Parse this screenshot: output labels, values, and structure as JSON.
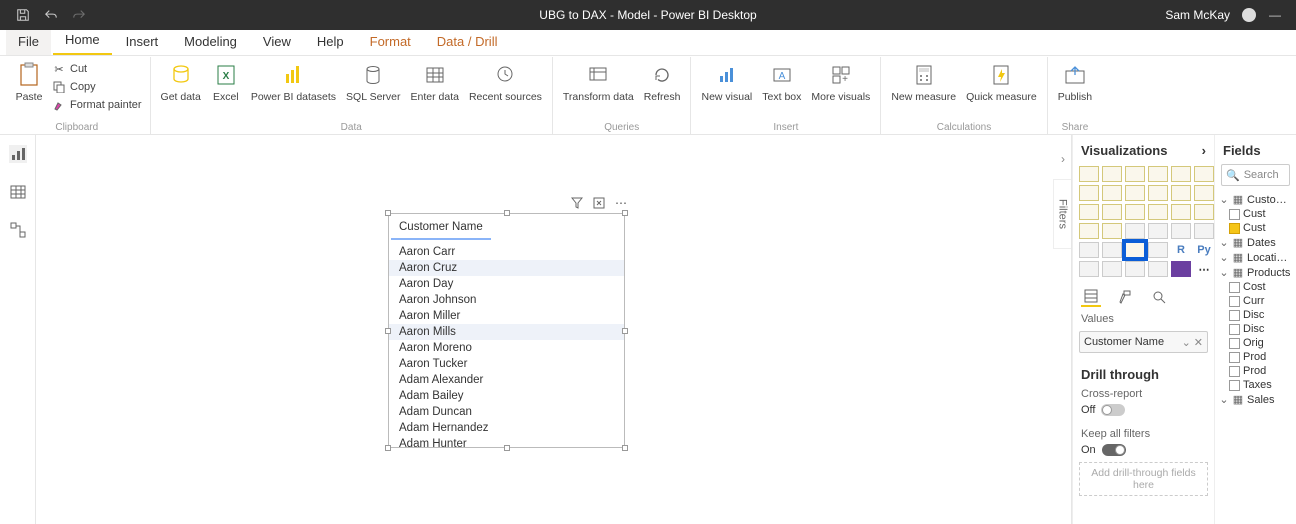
{
  "titlebar": {
    "title": "UBG to DAX - Model - Power BI Desktop",
    "user": "Sam McKay"
  },
  "tabs": {
    "file": "File",
    "home": "Home",
    "insert": "Insert",
    "modeling": "Modeling",
    "view": "View",
    "help": "Help",
    "format": "Format",
    "datadrill": "Data / Drill"
  },
  "ribbon": {
    "clipboard": {
      "label": "Clipboard",
      "paste": "Paste",
      "cut": "Cut",
      "copy": "Copy",
      "painter": "Format painter"
    },
    "data": {
      "label": "Data",
      "get": "Get\ndata",
      "excel": "Excel",
      "pbi": "Power BI\ndatasets",
      "sql": "SQL\nServer",
      "enter": "Enter\ndata",
      "recent": "Recent\nsources"
    },
    "queries": {
      "label": "Queries",
      "transform": "Transform\ndata",
      "refresh": "Refresh"
    },
    "insert": {
      "label": "Insert",
      "new": "New\nvisual",
      "text": "Text\nbox",
      "more": "More\nvisuals"
    },
    "calc": {
      "label": "Calculations",
      "measure": "New\nmeasure",
      "quick": "Quick\nmeasure"
    },
    "share": {
      "label": "Share",
      "publish": "Publish"
    }
  },
  "visual": {
    "header": "Customer Name",
    "rows": [
      "Aaron Carr",
      "Aaron Cruz",
      "Aaron Day",
      "Aaron Johnson",
      "Aaron Miller",
      "Aaron Mills",
      "Aaron Moreno",
      "Aaron Tucker",
      "Adam Alexander",
      "Adam Bailey",
      "Adam Duncan",
      "Adam Hernandez",
      "Adam Hunter"
    ]
  },
  "vizpane": {
    "title": "Visualizations",
    "values": "Values",
    "well": "Customer Name",
    "drill": "Drill through",
    "cross": "Cross-report",
    "off": "Off",
    "keep": "Keep all filters",
    "on": "On",
    "adddrill": "Add drill-through fields here"
  },
  "fieldspane": {
    "title": "Fields",
    "search": "Search",
    "customers": {
      "name": "Customers",
      "c1": "Cust",
      "c2": "Cust"
    },
    "dates": "Dates",
    "locations": "Locations",
    "products": {
      "name": "Products",
      "cost": "Cost",
      "curr": "Curr",
      "disc1": "Disc",
      "disc2": "Disc",
      "orig": "Orig",
      "prod1": "Prod",
      "prod2": "Prod",
      "taxes": "Taxes"
    },
    "sales": "Sales"
  },
  "filters": "Filters"
}
